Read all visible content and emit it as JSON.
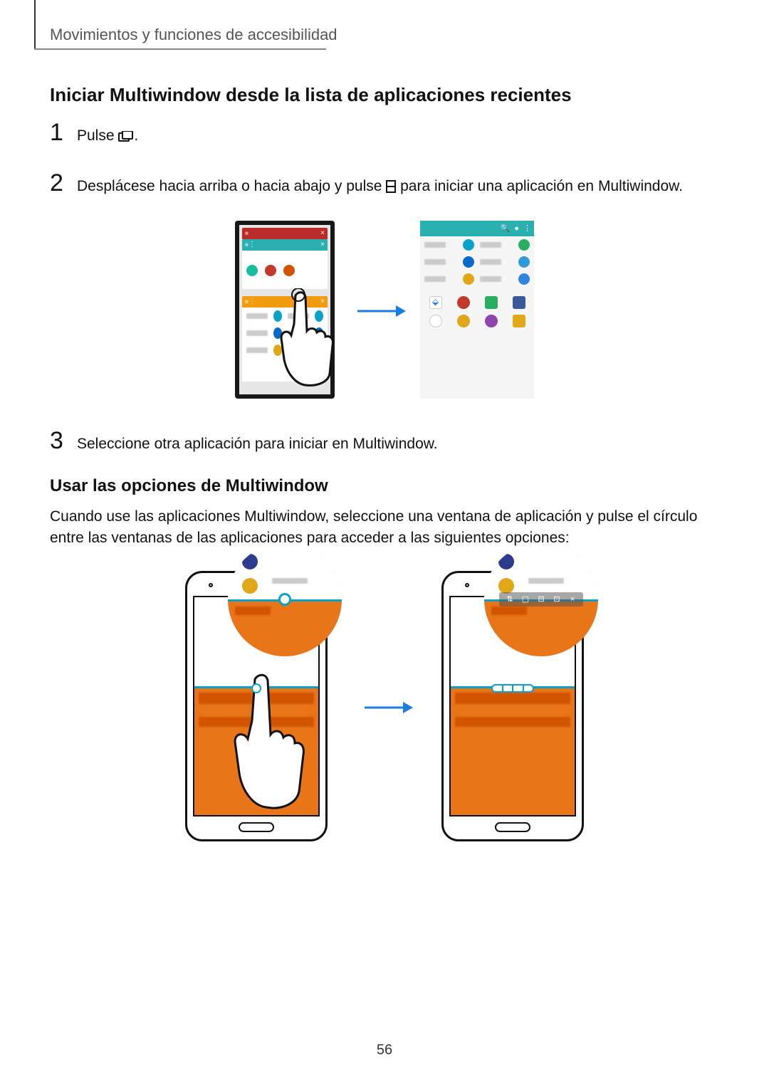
{
  "page_number": "56",
  "section_label": "Movimientos y funciones de accesibilidad",
  "heading_1": "Iniciar Multiwindow desde la lista de aplicaciones recientes",
  "steps": {
    "s1": {
      "num": "1",
      "text_before": "Pulse ",
      "text_after": "."
    },
    "s2": {
      "num": "2",
      "text_before": "Desplácese hacia arriba o hacia abajo y pulse ",
      "text_after": " para iniciar una aplicación en Multiwindow."
    },
    "s3": {
      "num": "3",
      "text": "Seleccione otra aplicación para iniciar en Multiwindow."
    }
  },
  "heading_2": "Usar las opciones de Multiwindow",
  "paragraph_2": "Cuando use las aplicaciones Multiwindow, seleccione una ventana de aplicación y pulse el círculo entre las ventanas de las aplicaciones para acceder a las siguientes opciones:",
  "icons": {
    "recent_apps": "recent-apps-icon",
    "split_view": "split-view-icon"
  }
}
